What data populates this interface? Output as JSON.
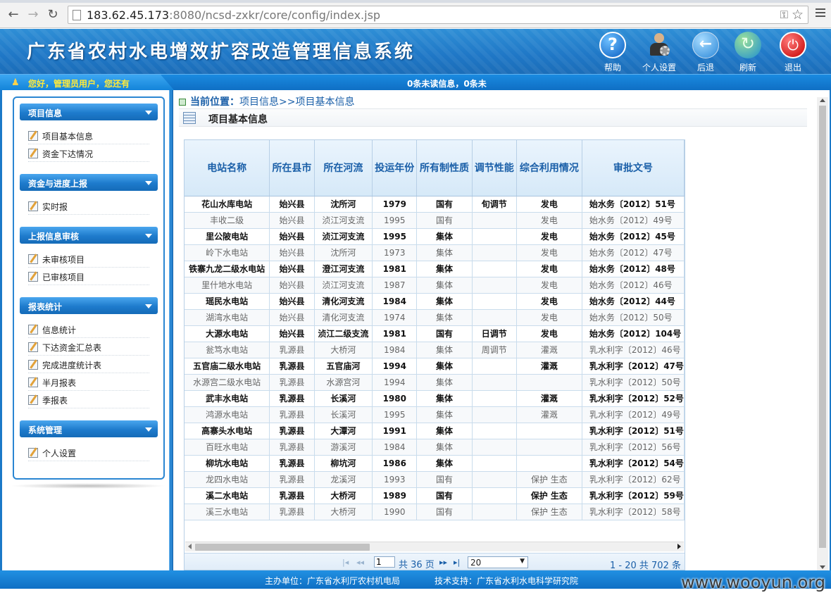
{
  "browser": {
    "url_host": "183.62.45.173",
    "url_rest": ":8080/ncsd-zxkr/core/config/index.jsp"
  },
  "app": {
    "title": "广东省农村水电增效扩容改造管理信息系统",
    "actions": {
      "help": "帮助",
      "personal": "个人设置",
      "back": "后退",
      "refresh": "刷新",
      "logout": "退出"
    },
    "welcome": "您好，管理员用户，您还有",
    "messages": "0条未读信息，0条未"
  },
  "sidebar": {
    "groups": [
      {
        "title": "项目信息",
        "items": [
          "项目基本信息",
          "资金下达情况"
        ]
      },
      {
        "title": "资金与进度上报",
        "items": [
          "实时报"
        ]
      },
      {
        "title": "上报信息审核",
        "items": [
          "未审核项目",
          "已审核项目"
        ]
      },
      {
        "title": "报表统计",
        "items": [
          "信息统计",
          "下达资金汇总表",
          "完成进度统计表",
          "半月报表",
          "季报表"
        ]
      },
      {
        "title": "系统管理",
        "items": [
          "个人设置"
        ]
      }
    ]
  },
  "location": {
    "label": "当前位置：",
    "path": "项目信息>>项目基本信息"
  },
  "panel_title": "项目基本信息",
  "table": {
    "columns": [
      "电站名称",
      "所在县市",
      "所在河流",
      "投运年份",
      "所有制性质",
      "调节性能",
      "综合利用情况",
      "审批文号"
    ],
    "rows": [
      [
        "花山水库电站",
        "始兴县",
        "沈所河",
        "1979",
        "国有",
        "旬调节",
        "发电",
        "始水务〔2012〕51号"
      ],
      [
        "丰收二级",
        "始兴县",
        "浈江河支流",
        "1995",
        "国有",
        "",
        "发电",
        "始水务〔2012〕49号"
      ],
      [
        "里公陂电站",
        "始兴县",
        "浈江河支流",
        "1995",
        "集体",
        "",
        "发电",
        "始水务〔2012〕45号"
      ],
      [
        "岭下水电站",
        "始兴县",
        "沈所河",
        "1973",
        "集体",
        "",
        "发电",
        "始水务〔2012〕47号"
      ],
      [
        "铁寨九龙二级水电站",
        "始兴县",
        "澄江河支流",
        "1981",
        "集体",
        "",
        "发电",
        "始水务〔2012〕48号"
      ],
      [
        "里什地水电站",
        "始兴县",
        "浈江河支流",
        "1987",
        "集体",
        "",
        "发电",
        "始水务〔2012〕46号"
      ],
      [
        "瑶民水电站",
        "始兴县",
        "清化河支流",
        "1984",
        "集体",
        "",
        "发电",
        "始水务〔2012〕44号"
      ],
      [
        "湖湾水电站",
        "始兴县",
        "清化河支流",
        "1974",
        "集体",
        "",
        "发电",
        "始水务〔2012〕50号"
      ],
      [
        "大源水电站",
        "始兴县",
        "浈江二级支流",
        "1981",
        "国有",
        "日调节",
        "发电",
        "始水务〔2012〕104号"
      ],
      [
        "瓮笃水电站",
        "乳源县",
        "大桥河",
        "1984",
        "集体",
        "周调节",
        "灌溉",
        "乳水利字〔2012〕46号"
      ],
      [
        "五官庙二级水电站",
        "乳源县",
        "五官庙河",
        "1994",
        "集体",
        "",
        "灌溉",
        "乳水利字〔2012〕47号"
      ],
      [
        "水源宫二级水电站",
        "乳源县",
        "水源宫河",
        "1994",
        "集体",
        "",
        "",
        "乳水利字〔2012〕50号"
      ],
      [
        "武丰水电站",
        "乳源县",
        "长溪河",
        "1980",
        "集体",
        "",
        "灌溉",
        "乳水利字〔2012〕52号"
      ],
      [
        "鸿源水电站",
        "乳源县",
        "长溪河",
        "1995",
        "集体",
        "",
        "灌溉",
        "乳水利字〔2012〕49号"
      ],
      [
        "高寨头水电站",
        "乳源县",
        "大潭河",
        "1991",
        "集体",
        "",
        "",
        "乳水利字〔2012〕51号"
      ],
      [
        "百旺水电站",
        "乳源县",
        "游溪河",
        "1984",
        "集体",
        "",
        "",
        "乳水利字〔2012〕56号"
      ],
      [
        "柳坑水电站",
        "乳源县",
        "柳坑河",
        "1986",
        "集体",
        "",
        "",
        "乳水利字〔2012〕54号"
      ],
      [
        "龙四水电站",
        "乳源县",
        "龙溪河",
        "1993",
        "国有",
        "",
        "保护  生态",
        "乳水利字〔2012〕62号"
      ],
      [
        "溪二水电站",
        "乳源县",
        "大桥河",
        "1989",
        "国有",
        "",
        "保护  生态",
        "乳水利字〔2012〕59号"
      ],
      [
        "溪三水电站",
        "乳源县",
        "大桥河",
        "1990",
        "国有",
        "",
        "保护  生态",
        "乳水利字〔2012〕58号"
      ]
    ]
  },
  "pager": {
    "first": "|◂",
    "prev": "◂◂",
    "page_value": "1",
    "total_pages": "共 36 页",
    "next": "▸▸",
    "last": "▸|",
    "page_size": "20",
    "range": "1 - 20  共 702 条"
  },
  "footer": {
    "host": "主办单位：广东省水利厅农村机电局",
    "tech": "技术支持：广东省水利水电科学研究院"
  },
  "watermark": "www.wooyun.org"
}
